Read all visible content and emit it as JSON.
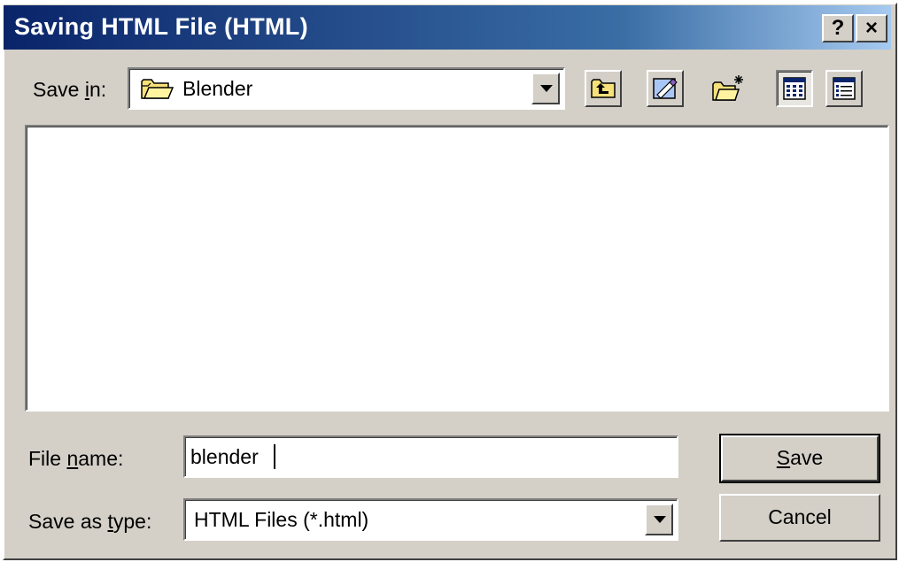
{
  "window": {
    "title": "Saving HTML File (HTML)",
    "help_label": "?",
    "close_label": "×"
  },
  "save_in": {
    "label_pre": "Save ",
    "label_accel": "i",
    "label_post": "n:",
    "value": "Blender",
    "folder_icon": "folder-icon"
  },
  "toolbar": {
    "icons": [
      "up-one-level-icon",
      "desktop-icon",
      "new-folder-icon",
      "list-view-icon",
      "details-view-icon"
    ]
  },
  "file_name": {
    "label_pre": "File ",
    "label_accel": "n",
    "label_post": "ame:",
    "value": "blender"
  },
  "save_as_type": {
    "label_pre": "Save as ",
    "label_accel": "t",
    "label_post": "ype:",
    "value": "HTML Files (*.html)"
  },
  "buttons": {
    "save_accel": "S",
    "save_rest": "ave",
    "cancel": "Cancel"
  },
  "colors": {
    "titlebar_start": "#0a246a",
    "titlebar_end": "#a6caf0",
    "face": "#d4d0c8"
  }
}
